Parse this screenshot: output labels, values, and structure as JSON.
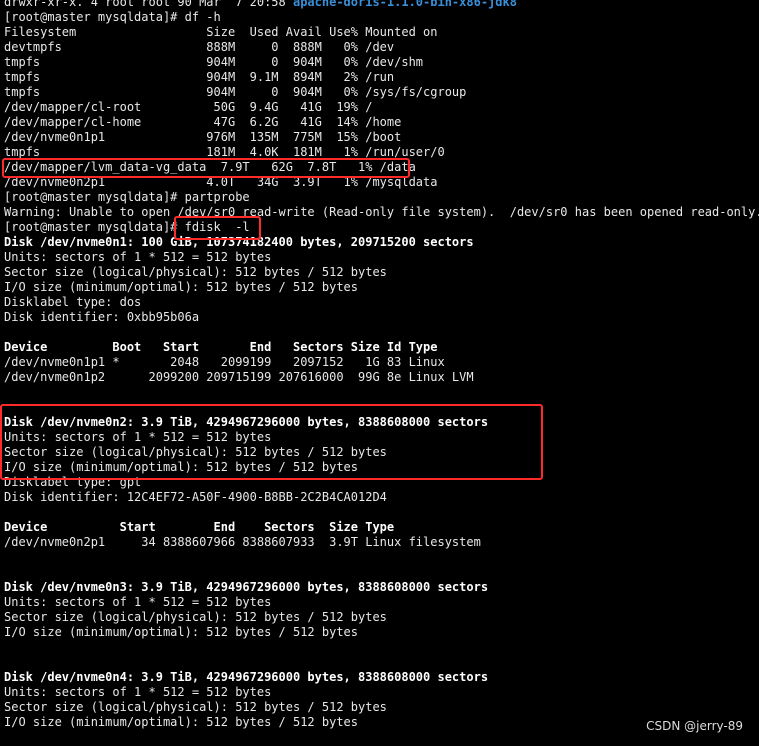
{
  "terminal": {
    "top_partial_perm": "drwxr-xr-x. 4 root root 90 Mar  7 20:58 ",
    "top_partial_dir": "apache-doris-1.1.0-bin-x86-jdk8",
    "lines": [
      "[root@master mysqldata]# df -h",
      "Filesystem                  Size  Used Avail Use% Mounted on",
      "devtmpfs                    888M     0  888M   0% /dev",
      "tmpfs                       904M     0  904M   0% /dev/shm",
      "tmpfs                       904M  9.1M  894M   2% /run",
      "tmpfs                       904M     0  904M   0% /sys/fs/cgroup",
      "/dev/mapper/cl-root          50G  9.4G   41G  19% /",
      "/dev/mapper/cl-home          47G  6.2G   41G  14% /home",
      "/dev/nvme0n1p1              976M  135M  775M  15% /boot",
      "tmpfs                       181M  4.0K  181M   1% /run/user/0",
      "/dev/mapper/lvm_data-vg_data  7.9T   62G  7.8T   1% /data",
      "/dev/nvme0n2p1              4.0T   34G  3.9T   1% /mysqldata",
      "[root@master mysqldata]# partprobe",
      "Warning: Unable to open /dev/sr0 read-write (Read-only file system).  /dev/sr0 has been opened read-only.",
      "[root@master mysqldata]# fdisk  -l",
      "Disk /dev/nvme0n1: 100 GiB, 107374182400 bytes, 209715200 sectors",
      "Units: sectors of 1 * 512 = 512 bytes",
      "Sector size (logical/physical): 512 bytes / 512 bytes",
      "I/O size (minimum/optimal): 512 bytes / 512 bytes",
      "Disklabel type: dos",
      "Disk identifier: 0xbb95b06a",
      "",
      "Device         Boot   Start       End   Sectors Size Id Type",
      "/dev/nvme0n1p1 *       2048   2099199   2097152   1G 83 Linux",
      "/dev/nvme0n1p2      2099200 209715199 207616000  99G 8e Linux LVM",
      "",
      "",
      "Disk /dev/nvme0n2: 3.9 TiB, 4294967296000 bytes, 8388608000 sectors",
      "Units: sectors of 1 * 512 = 512 bytes",
      "Sector size (logical/physical): 512 bytes / 512 bytes",
      "I/O size (minimum/optimal): 512 bytes / 512 bytes",
      "Disklabel type: gpt",
      "Disk identifier: 12C4EF72-A50F-4900-B8BB-2C2B4CA012D4",
      "",
      "Device          Start        End    Sectors  Size Type",
      "/dev/nvme0n2p1     34 8388607966 8388607933  3.9T Linux filesystem",
      "",
      "",
      "Disk /dev/nvme0n3: 3.9 TiB, 4294967296000 bytes, 8388608000 sectors",
      "Units: sectors of 1 * 512 = 512 bytes",
      "Sector size (logical/physical): 512 bytes / 512 bytes",
      "I/O size (minimum/optimal): 512 bytes / 512 bytes",
      "",
      "",
      "Disk /dev/nvme0n4: 3.9 TiB, 4294967296000 bytes, 8388608000 sectors",
      "Units: sectors of 1 * 512 = 512 bytes",
      "Sector size (logical/physical): 512 bytes / 512 bytes",
      "I/O size (minimum/optimal): 512 bytes / 512 bytes"
    ],
    "bold_line_indices": [
      15,
      22,
      27,
      34,
      38,
      44
    ]
  },
  "highlight_color": "#ff2a2a",
  "watermark": "CSDN @jerry-89"
}
